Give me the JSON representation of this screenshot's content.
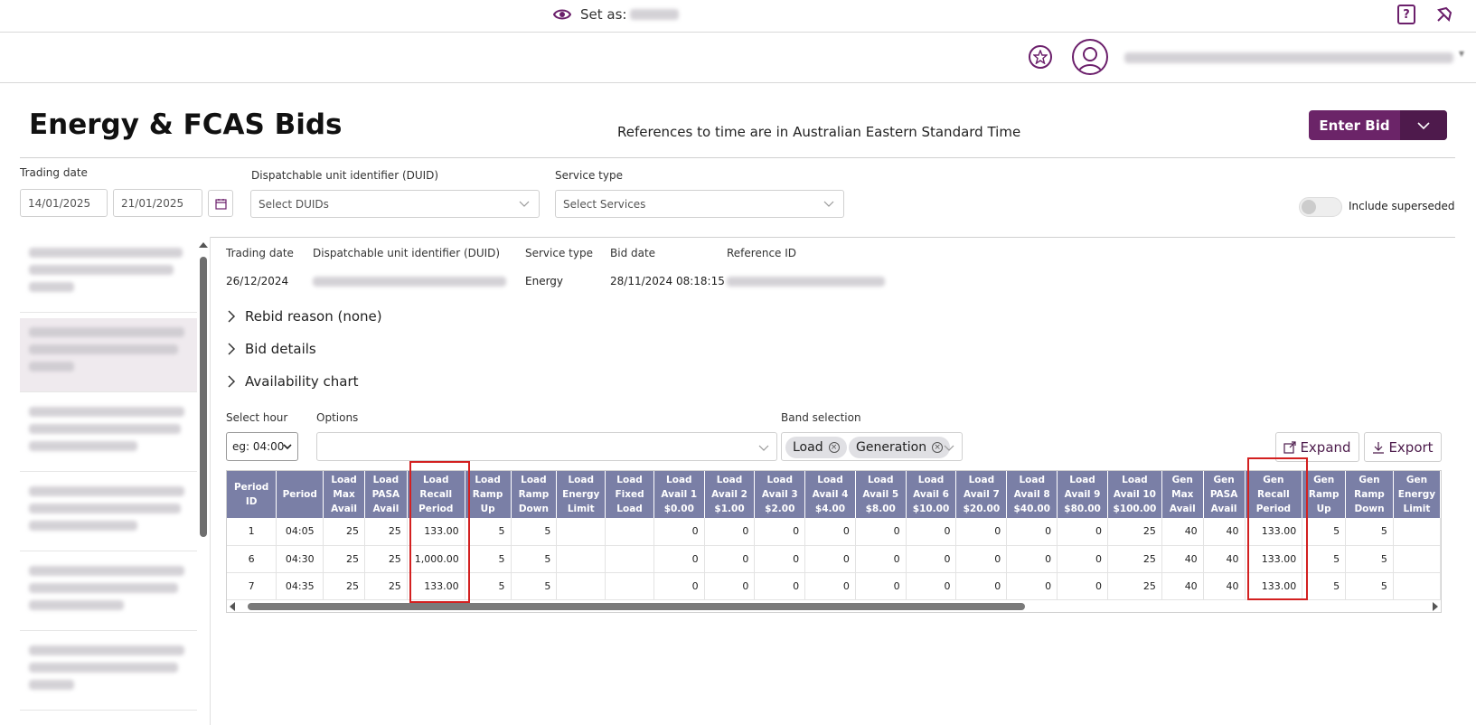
{
  "topbar": {
    "set_as_label": "Set as:"
  },
  "page": {
    "title": "Energy & FCAS Bids",
    "tz_note": "References to time are in Australian Eastern Standard Time",
    "enter_bid": "Enter Bid"
  },
  "filters": {
    "trading_date_label": "Trading date",
    "date_from": "14/01/2025",
    "date_to": "21/01/2025",
    "duid_label": "Dispatchable unit identifier (DUID)",
    "duid_placeholder": "Select DUIDs",
    "service_label": "Service type",
    "service_placeholder": "Select Services",
    "include_superseded": "Include superseded"
  },
  "detail": {
    "headers": {
      "trading_date": "Trading date",
      "duid": "Dispatchable unit identifier (DUID)",
      "service_type": "Service type",
      "bid_date": "Bid date",
      "reference_id": "Reference ID"
    },
    "values": {
      "trading_date": "26/12/2024",
      "service_type": "Energy",
      "bid_date": "28/11/2024 08:18:15"
    },
    "accordions": [
      "Rebid reason (none)",
      "Bid details",
      "Availability chart"
    ]
  },
  "controls": {
    "select_hour_label": "Select hour",
    "select_hour_value": "eg: 04:00",
    "options_label": "Options",
    "band_label": "Band selection",
    "bands": [
      "Load",
      "Generation"
    ],
    "expand": "Expand",
    "export": "Export"
  },
  "table": {
    "columns": [
      "Period ID",
      "Period",
      "Load Max Avail",
      "Load PASA Avail",
      "Load Recall Period",
      "Load Ramp Up",
      "Load Ramp Down",
      "Load Energy Limit",
      "Load Fixed Load",
      "Load Avail 1 $0.00",
      "Load Avail 2 $1.00",
      "Load Avail 3 $2.00",
      "Load Avail 4 $4.00",
      "Load Avail 5 $8.00",
      "Load Avail 6 $10.00",
      "Load Avail 7 $20.00",
      "Load Avail 8 $40.00",
      "Load Avail 9 $80.00",
      "Load Avail 10 $100.00",
      "Gen Max Avail",
      "Gen PASA Avail",
      "Gen Recall Period",
      "Gen Ramp Up",
      "Gen Ramp Down",
      "Gen Energy Limit"
    ],
    "rows": [
      [
        "1",
        "04:05",
        "25",
        "25",
        "133.00",
        "5",
        "5",
        "",
        "",
        "0",
        "0",
        "0",
        "0",
        "0",
        "0",
        "0",
        "0",
        "0",
        "25",
        "40",
        "40",
        "133.00",
        "5",
        "5",
        ""
      ],
      [
        "6",
        "04:30",
        "25",
        "25",
        "1,000.00",
        "5",
        "5",
        "",
        "",
        "0",
        "0",
        "0",
        "0",
        "0",
        "0",
        "0",
        "0",
        "0",
        "25",
        "40",
        "40",
        "133.00",
        "5",
        "5",
        ""
      ],
      [
        "7",
        "04:35",
        "25",
        "25",
        "133.00",
        "5",
        "5",
        "",
        "",
        "0",
        "0",
        "0",
        "0",
        "0",
        "0",
        "0",
        "0",
        "0",
        "25",
        "40",
        "40",
        "133.00",
        "5",
        "5",
        ""
      ]
    ]
  },
  "colors": {
    "brand": "#6b2468",
    "brand_dark": "#4e1a4c",
    "table_header": "#7a7fa6",
    "highlight": "#d32020"
  }
}
